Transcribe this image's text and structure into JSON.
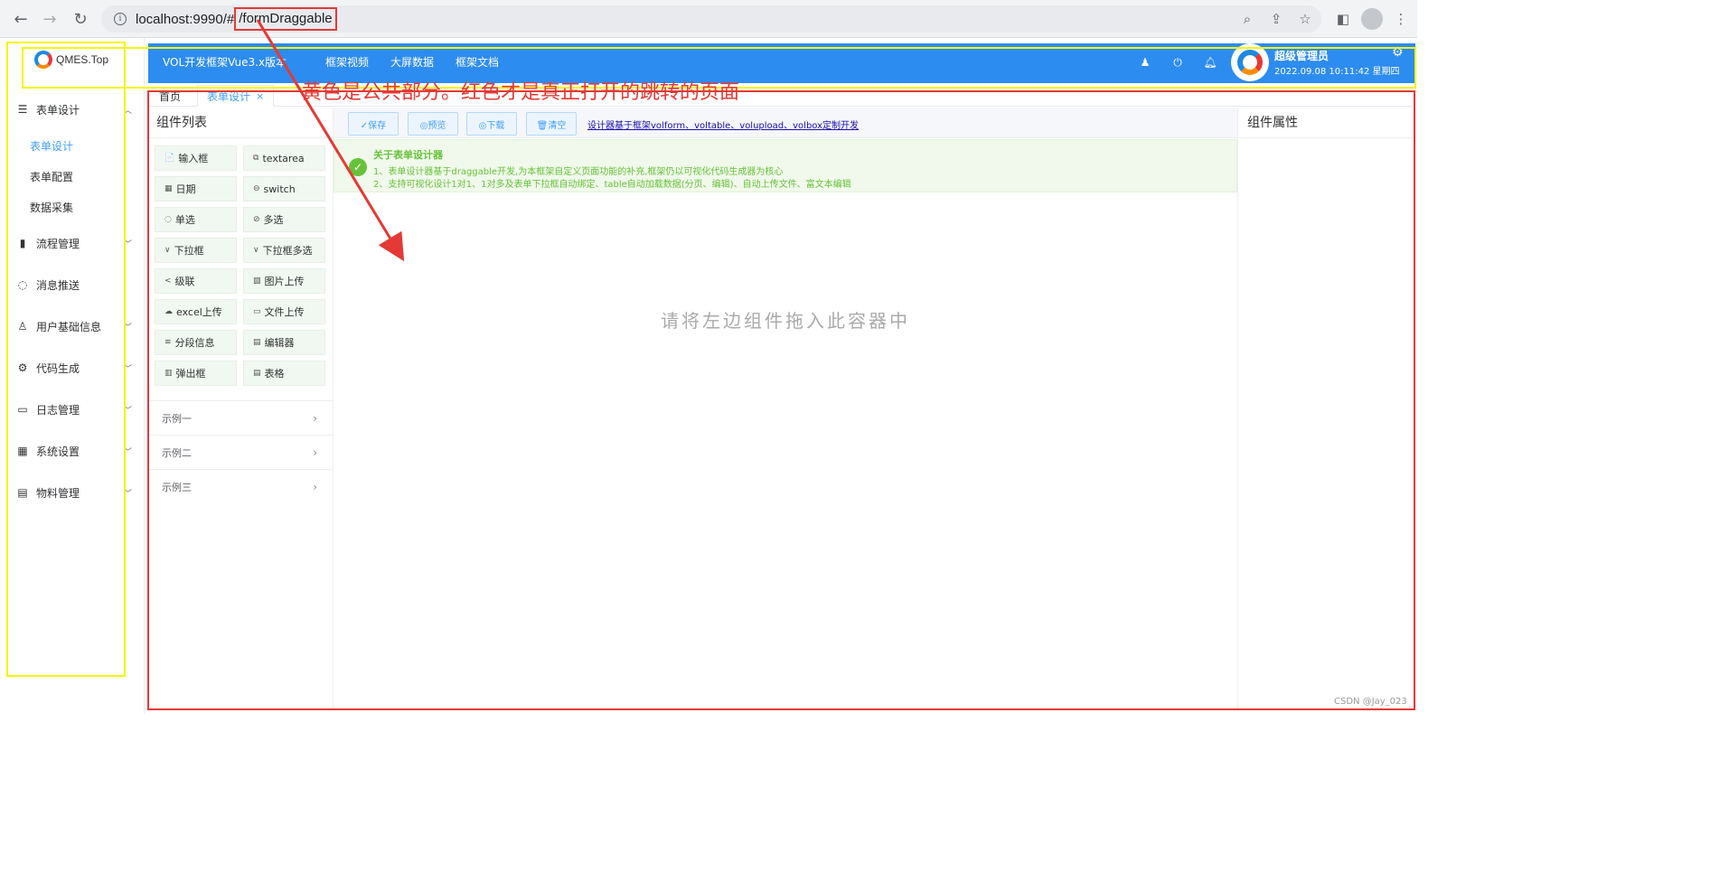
{
  "browser": {
    "url_host": "localhost:9990/#",
    "url_path": "/formDraggable"
  },
  "sidebar": {
    "logo_text": "QMES.Top",
    "menu": [
      {
        "label": "表单设计",
        "icon": "sliders-icon",
        "arrow": "^"
      },
      {
        "label": "流程管理",
        "icon": "clipboard-icon",
        "arrow": "v"
      },
      {
        "label": "消息推送",
        "icon": "chat-icon",
        "arrow": ""
      },
      {
        "label": "用户基础信息",
        "icon": "user-icon",
        "arrow": "v"
      },
      {
        "label": "代码生成",
        "icon": "gear-icon",
        "arrow": "v"
      },
      {
        "label": "日志管理",
        "icon": "log-icon",
        "arrow": "v"
      },
      {
        "label": "系统设置",
        "icon": "grid-icon",
        "arrow": "v"
      },
      {
        "label": "物料管理",
        "icon": "box-icon",
        "arrow": "v"
      }
    ],
    "submenu": [
      "表单设计",
      "表单配置",
      "数据采集"
    ]
  },
  "header": {
    "brand": "VOL开发框架Vue3.x版本",
    "nav": [
      "框架视频",
      "大屏数据",
      "框架文档"
    ],
    "user_name": "超级管理员",
    "datetime": "2022.09.08 10:11:42 星期四"
  },
  "tabs": {
    "home": "首页",
    "active": "表单设计",
    "close": "×"
  },
  "components": {
    "title": "组件列表",
    "items": [
      {
        "label": "输入框",
        "icon": "📄"
      },
      {
        "label": "textarea",
        "icon": "⧉"
      },
      {
        "label": "日期",
        "icon": "▦"
      },
      {
        "label": "switch",
        "icon": "⊖"
      },
      {
        "label": "单选",
        "icon": "◌"
      },
      {
        "label": "多选",
        "icon": "⊘"
      },
      {
        "label": "下拉框",
        "icon": "∨"
      },
      {
        "label": "下拉框多选",
        "icon": "∨"
      },
      {
        "label": "级联",
        "icon": "<"
      },
      {
        "label": "图片上传",
        "icon": "▧"
      },
      {
        "label": "excel上传",
        "icon": "☁"
      },
      {
        "label": "文件上传",
        "icon": "▭"
      },
      {
        "label": "分段信息",
        "icon": "≋"
      },
      {
        "label": "编辑器",
        "icon": "▤"
      },
      {
        "label": "弹出框",
        "icon": "▥"
      },
      {
        "label": "表格",
        "icon": "▤"
      }
    ],
    "examples": [
      "示例一",
      "示例二",
      "示例三"
    ]
  },
  "toolbar": {
    "save": "✓保存",
    "preview": "◎预览",
    "download": "◎下载",
    "clear": "🗑清空",
    "link": "设计器基于框架volform、voltable、volupload、volbox定制开发"
  },
  "alert": {
    "title": "关于表单设计器",
    "line1": "1、表单设计器基于draggable开发,为本框架自定义页面功能的补充,框架仍以可视化代码生成器为核心",
    "line2": "2、支持可视化设计1对1、1对多及表单下拉框自动绑定、table自动加载数据(分页、编辑)、自动上传文件、富文本编辑"
  },
  "canvas": {
    "placeholder": "请将左边组件拖入此容器中"
  },
  "props": {
    "title": "组件属性"
  },
  "annotation": {
    "text": "黄色是公共部分。红色才是真正打开的跳转的页面",
    "yellow": "#f5f500",
    "red": "#e53935"
  },
  "colors": {
    "header_blue": "#2d8cf0",
    "active_blue": "#409eff",
    "success_green": "#67c23a"
  },
  "watermark": "CSDN @Jay_023"
}
